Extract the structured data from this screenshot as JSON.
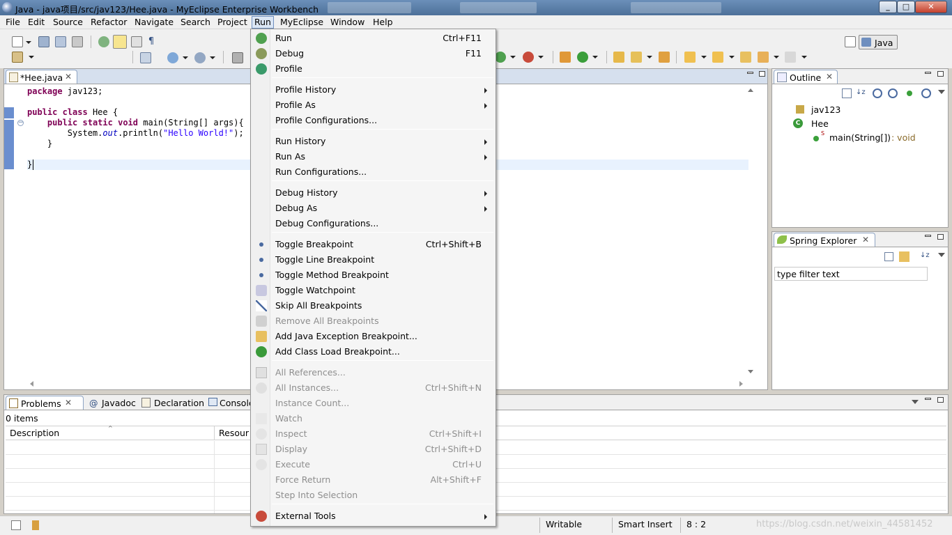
{
  "window": {
    "title": "Java - java项目/src/jav123/Hee.java - MyEclipse Enterprise Workbench"
  },
  "menubar": [
    "File",
    "Edit",
    "Source",
    "Refactor",
    "Navigate",
    "Search",
    "Project",
    "Run",
    "MyEclipse",
    "Window",
    "Help"
  ],
  "perspective": {
    "label": "Java"
  },
  "editor": {
    "tab_label": "*Hee.java",
    "lines": [
      "package jav123;",
      "",
      "public class Hee {",
      "    public static void main(String[] args){",
      "        System.out.println(\"Hello World!\");",
      "    }",
      "",
      "}"
    ]
  },
  "outline": {
    "tab_label": "Outline",
    "package": "jav123",
    "class": "Hee",
    "method": "main(String[])",
    "method_type": " : void",
    "static_marker": "S"
  },
  "spring": {
    "tab_label": "Spring Explorer",
    "filter_value": "type filter text"
  },
  "bottom": {
    "tabs": [
      "Problems",
      "Javadoc",
      "Declaration",
      "Console"
    ],
    "summary": "0 items",
    "columns": [
      "Description",
      "Resour"
    ]
  },
  "status": {
    "writable": "Writable",
    "insert_mode": "Smart Insert",
    "position": "8 : 2",
    "watermark": "https://blog.csdn.net/weixin_44581452"
  },
  "run_menu": {
    "items": [
      {
        "label": "Run",
        "shortcut": "Ctrl+F11",
        "icon": "run-icon"
      },
      {
        "label": "Debug",
        "shortcut": "F11",
        "icon": "debug-icon"
      },
      {
        "label": "Profile",
        "shortcut": "",
        "icon": "profile-icon"
      },
      {
        "label": "Profile History",
        "shortcut": "",
        "submenu": true
      },
      {
        "label": "Profile As",
        "shortcut": "",
        "submenu": true
      },
      {
        "label": "Profile Configurations...",
        "shortcut": ""
      },
      {
        "label": "Run History",
        "shortcut": "",
        "submenu": true
      },
      {
        "label": "Run As",
        "shortcut": "",
        "submenu": true
      },
      {
        "label": "Run Configurations...",
        "shortcut": ""
      },
      {
        "label": "Debug History",
        "shortcut": "",
        "submenu": true
      },
      {
        "label": "Debug As",
        "shortcut": "",
        "submenu": true
      },
      {
        "label": "Debug Configurations...",
        "shortcut": ""
      },
      {
        "label": "Toggle Breakpoint",
        "shortcut": "Ctrl+Shift+B",
        "icon": "breakpoint-icon"
      },
      {
        "label": "Toggle Line Breakpoint",
        "shortcut": "",
        "icon": "line-breakpoint-icon"
      },
      {
        "label": "Toggle Method Breakpoint",
        "shortcut": "",
        "icon": "method-breakpoint-icon"
      },
      {
        "label": "Toggle Watchpoint",
        "shortcut": "",
        "icon": "watchpoint-icon"
      },
      {
        "label": "Skip All Breakpoints",
        "shortcut": "",
        "icon": "skip-breakpoints-icon"
      },
      {
        "label": "Remove All Breakpoints",
        "shortcut": "",
        "disabled": true,
        "icon": "remove-breakpoints-icon"
      },
      {
        "label": "Add Java Exception Breakpoint...",
        "shortcut": "",
        "icon": "exception-breakpoint-icon"
      },
      {
        "label": "Add Class Load Breakpoint...",
        "shortcut": "",
        "icon": "class-load-breakpoint-icon"
      },
      {
        "label": "All References...",
        "shortcut": "",
        "disabled": true,
        "icon": "references-icon"
      },
      {
        "label": "All Instances...",
        "shortcut": "Ctrl+Shift+N",
        "disabled": true,
        "icon": "instances-icon"
      },
      {
        "label": "Instance Count...",
        "shortcut": "",
        "disabled": true
      },
      {
        "label": "Watch",
        "shortcut": "",
        "disabled": true,
        "icon": "watch-icon"
      },
      {
        "label": "Inspect",
        "shortcut": "Ctrl+Shift+I",
        "disabled": true,
        "icon": "inspect-icon"
      },
      {
        "label": "Display",
        "shortcut": "Ctrl+Shift+D",
        "disabled": true,
        "icon": "display-icon"
      },
      {
        "label": "Execute",
        "shortcut": "Ctrl+U",
        "disabled": true,
        "icon": "execute-icon"
      },
      {
        "label": "Force Return",
        "shortcut": "Alt+Shift+F",
        "disabled": true
      },
      {
        "label": "Step Into Selection",
        "shortcut": "",
        "disabled": true
      },
      {
        "label": "External Tools",
        "shortcut": "",
        "submenu": true,
        "icon": "external-tools-icon"
      }
    ]
  },
  "colors": {
    "keyword": "#7f0055",
    "string": "#2a00ff",
    "menu_highlight": "#dbe6f4",
    "ruler_mark": "#6a8ecf"
  }
}
